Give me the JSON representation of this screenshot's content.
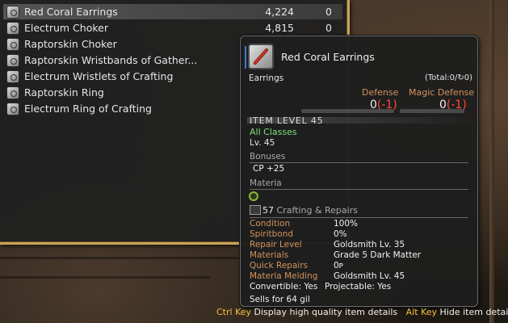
{
  "item_list": [
    {
      "name": "Red Coral Earrings",
      "price": "4,224",
      "qty": "0",
      "icon": "earring-icon",
      "selected": true
    },
    {
      "name": "Electrum Choker",
      "price": "4,815",
      "qty": "0",
      "icon": "choker-icon",
      "selected": false
    },
    {
      "name": "Raptorskin Choker",
      "price": "",
      "qty": "",
      "icon": "choker-icon",
      "selected": false
    },
    {
      "name": "Raptorskin Wristbands of Gather...",
      "price": "",
      "qty": "",
      "icon": "wristband-icon",
      "selected": false
    },
    {
      "name": "Electrum Wristlets of Crafting",
      "price": "",
      "qty": "",
      "icon": "wristlet-icon",
      "selected": false
    },
    {
      "name": "Raptorskin Ring",
      "price": "",
      "qty": "",
      "icon": "ring-icon",
      "selected": false
    },
    {
      "name": "Electrum Ring of Crafting",
      "price": "",
      "qty": "",
      "icon": "ring-icon",
      "selected": false
    }
  ],
  "tooltip": {
    "title": "Red Coral Earrings",
    "category": "Earrings",
    "total_prefix": "(Total:",
    "total_value": "0",
    "total_suffix": "/",
    "total_alt_value": "0)",
    "defense_label": "Defense",
    "defense_value": "0",
    "defense_diff": "(-1)",
    "magic_defense_label": "Magic Defense",
    "magic_defense_value": "0",
    "magic_defense_diff": "(-1)",
    "item_level": "ITEM LEVEL 45",
    "classes": "All Classes",
    "level": "Lv. 45",
    "bonuses_label": "Bonuses",
    "bonus": "CP +25",
    "materia_label": "Materia",
    "craft_level": "57",
    "craft_label": "Crafting & Repairs",
    "details": [
      {
        "label": "Condition",
        "value": "100%"
      },
      {
        "label": "Spiritbond",
        "value": "0%"
      },
      {
        "label": "Repair Level",
        "value": "Goldsmith Lv. 35"
      },
      {
        "label": "Materials",
        "value": "Grade 5 Dark Matter"
      },
      {
        "label": "Quick Repairs",
        "value": "0ᴩ"
      },
      {
        "label": "Materia Melding",
        "value": "Goldsmith Lv. 45"
      }
    ],
    "convertible": "Convertible: Yes",
    "projectable": "Projectable: Yes",
    "sells_for": "Sells for 64 gil"
  },
  "hints": {
    "ctrl_key": "Ctrl Key",
    "ctrl_text": "Display high quality item details",
    "alt_key": "Alt Key",
    "alt_text": "Hide item details"
  },
  "colors": {
    "frame_gold": "#c7a45c",
    "label_orange": "#d2935d",
    "negative_red": "#ff4a3a",
    "class_green": "#7ee07e",
    "key_yellow": "#f3c13f",
    "accent_blue": "#3d7bd6"
  }
}
